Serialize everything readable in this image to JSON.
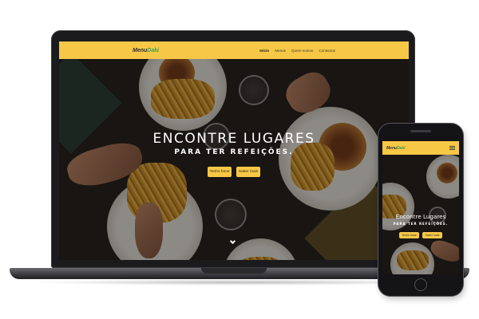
{
  "site": {
    "logo_main": "Menu",
    "logo_accent": "Daki",
    "nav_items": [
      "Início",
      "Menus",
      "Quem somos",
      "Contactos"
    ],
    "hero_title": "ENCONTRE LUGARES",
    "hero_subtitle": "PARA TER REFEIÇÕES.",
    "btn_hungry": "Tenho fome",
    "btn_more": "Saber mais"
  },
  "mobile": {
    "hero_title": "Encontre Lugares",
    "hero_subtitle": "PARA TER REFEIÇÕES."
  },
  "colors": {
    "nav_bg": "#f7c846",
    "logo_accent": "#3e9b4f",
    "button_bg": "#f7c846"
  },
  "icons": {
    "scroll_down": "chevron-down-icon",
    "menu": "hamburger-menu-icon"
  }
}
